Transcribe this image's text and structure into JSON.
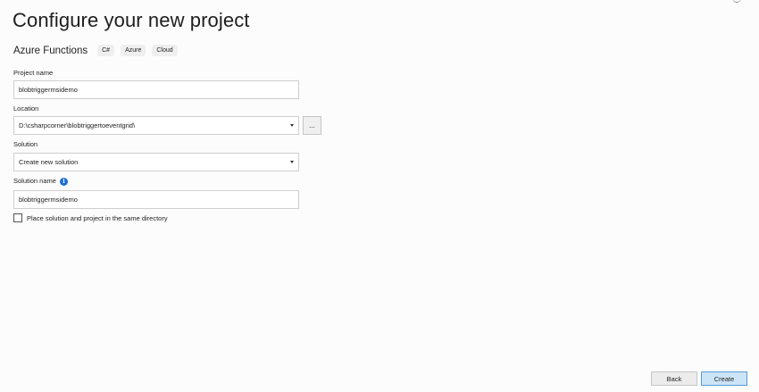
{
  "header": {
    "title": "Configure your new project"
  },
  "template": {
    "name": "Azure Functions",
    "tags": [
      "C#",
      "Azure",
      "Cloud"
    ]
  },
  "form": {
    "project_name_label": "Project name",
    "project_name_value": "blobtriggermsidemo",
    "location_label": "Location",
    "location_value": "D:\\csharpcorner\\blobtriggertoeventgrid\\",
    "browse_label": "...",
    "solution_label": "Solution",
    "solution_value": "Create new solution",
    "solution_name_label": "Solution name",
    "solution_name_value": "blobtriggermsidemo",
    "info_icon_glyph": "i",
    "same_directory_label": "Place solution and project in the same directory",
    "same_directory_checked": false
  },
  "footer": {
    "back_label": "Back",
    "create_label": "Create"
  },
  "colors": {
    "accent": "#1c6fd1",
    "primary_button_bg": "#cce4f7",
    "primary_button_border": "#5a9bd8"
  }
}
